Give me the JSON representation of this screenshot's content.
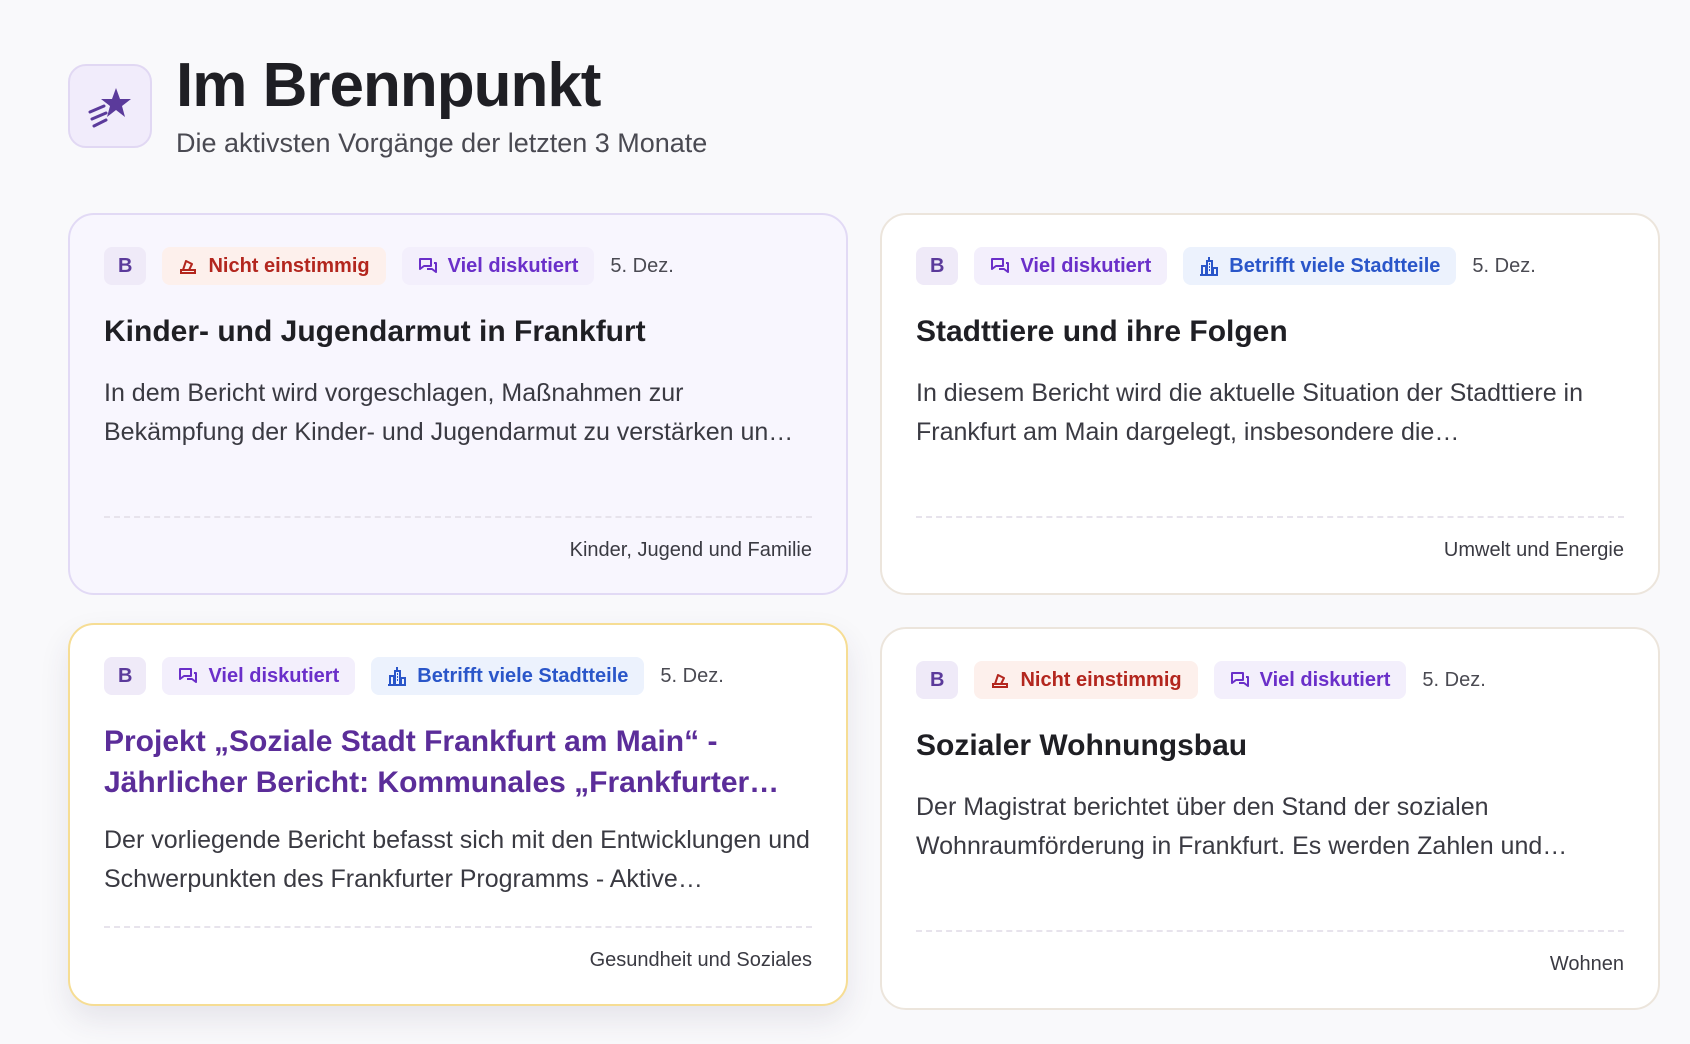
{
  "header": {
    "title": "Im Brennpunkt",
    "subtitle": "Die aktivsten Vorgänge der letzten 3 Monate",
    "icon": "shooting-star-icon"
  },
  "colors": {
    "accent": "#5b3a9b",
    "red_badge": "#b3261e",
    "purple_badge": "#6a2fc9",
    "blue_badge": "#2a56c9"
  },
  "cards": [
    {
      "type_badge": "B",
      "badges": [
        "Nicht einstimmig",
        "Viel diskutiert"
      ],
      "date": "5. Dez.",
      "title": "Kinder- und Jugendarmut in Frankfurt",
      "description": "In dem Bericht wird vorgeschlagen, Maßnahmen zur Bekämpfung der Kinder- und Jugendarmut zu verstärken un…",
      "category": "Kinder, Jugend und Familie"
    },
    {
      "type_badge": "B",
      "badges": [
        "Viel diskutiert",
        "Betrifft viele Stadtteile"
      ],
      "date": "5. Dez.",
      "title": "Stadttiere und ihre Folgen",
      "description": "In diesem Bericht wird die aktuelle Situation der Stadttiere in Frankfurt am Main dargelegt, insbesondere die…",
      "category": "Umwelt und Energie"
    },
    {
      "type_badge": "B",
      "badges": [
        "Viel diskutiert",
        "Betrifft viele Stadtteile"
      ],
      "date": "5. Dez.",
      "title": "Projekt „Soziale Stadt Frankfurt am Main“ - Jährlicher Bericht: Kommunales „Frankfurter…",
      "description": "Der vorliegende Bericht befasst sich mit den Entwicklungen und Schwerpunkten des Frankfurter Programms - Aktive…",
      "category": "Gesundheit und Soziales"
    },
    {
      "type_badge": "B",
      "badges": [
        "Nicht einstimmig",
        "Viel diskutiert"
      ],
      "date": "5. Dez.",
      "title": "Sozialer Wohnungsbau",
      "description": "Der Magistrat berichtet über den Stand der sozialen Wohnraumförderung in Frankfurt. Es werden Zahlen und…",
      "category": "Wohnen"
    }
  ]
}
